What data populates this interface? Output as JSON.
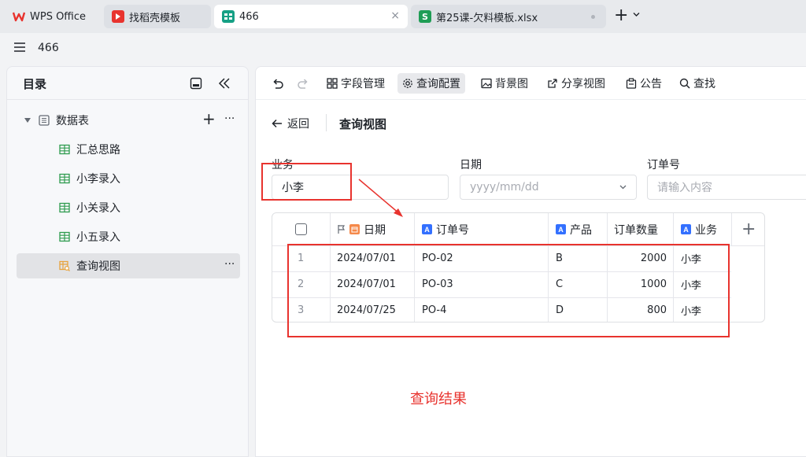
{
  "tabs": [
    {
      "label": "WPS Office",
      "icon": "wps-logo-icon"
    },
    {
      "label": "找稻壳模板",
      "icon": "docer-icon"
    },
    {
      "label": "466",
      "icon": "dbsheet-icon"
    },
    {
      "label": "第25课-欠料模板.xlsx",
      "icon": "spreadsheet-icon"
    }
  ],
  "tab_close_symbol": "×",
  "new_tab_symbol": "+",
  "doc_title": "466",
  "sidebar": {
    "title": "目录",
    "root": {
      "label": "数据表"
    },
    "items": [
      {
        "label": "汇总思路"
      },
      {
        "label": "小李录入"
      },
      {
        "label": "小关录入"
      },
      {
        "label": "小五录入"
      },
      {
        "label": "查询视图"
      }
    ],
    "more_symbol": "···",
    "add_symbol": "+"
  },
  "toolbar": {
    "field_manage": "字段管理",
    "query_config": "查询配置",
    "background": "背景图",
    "share_view": "分享视图",
    "notice": "公告",
    "find": "查找"
  },
  "view": {
    "back": "返回",
    "title": "查询视图"
  },
  "filters": {
    "business_label": "业务",
    "business_value": "小李",
    "date_label": "日期",
    "date_placeholder": "yyyy/mm/dd",
    "order_label": "订单号",
    "order_placeholder": "请输入内容"
  },
  "table": {
    "headers": [
      "日期",
      "订单号",
      "产品",
      "订单数量",
      "业务"
    ],
    "rows": [
      {
        "no": "1",
        "date": "2024/07/01",
        "order": "PO-02",
        "product": "B",
        "qty": "2000",
        "biz": "小李"
      },
      {
        "no": "2",
        "date": "2024/07/01",
        "order": "PO-03",
        "product": "C",
        "qty": "1000",
        "biz": "小李"
      },
      {
        "no": "3",
        "date": "2024/07/25",
        "order": "PO-4",
        "product": "D",
        "qty": "800",
        "biz": "小李"
      }
    ],
    "add_col_symbol": "+",
    "text_field_badge": "A"
  },
  "annotation": "查询结果",
  "colors": {
    "accent": "#3370ff",
    "annotation": "#e8332e",
    "grid_icon": "#2e9b4e"
  }
}
